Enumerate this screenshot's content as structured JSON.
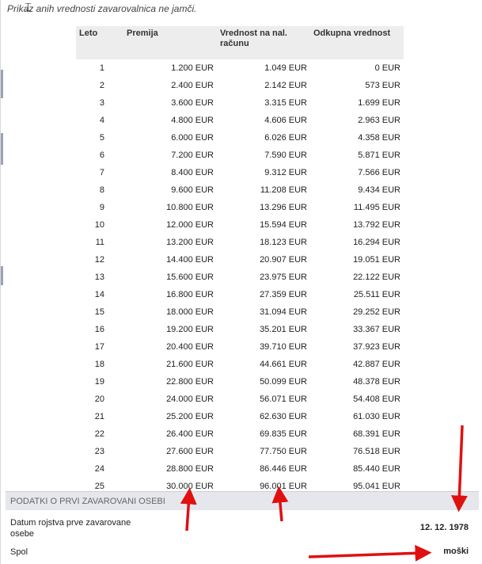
{
  "intro_text": "Prikaz anih vrednosti zavarovalnica ne jamči.",
  "table": {
    "headers": [
      "Leto",
      "Premija",
      "Vrednost na nal. računu",
      "Odkupna vrednost"
    ],
    "rows": [
      [
        "1",
        "1.200 EUR",
        "1.049 EUR",
        "0 EUR"
      ],
      [
        "2",
        "2.400 EUR",
        "2.142 EUR",
        "573 EUR"
      ],
      [
        "3",
        "3.600 EUR",
        "3.315 EUR",
        "1.699 EUR"
      ],
      [
        "4",
        "4.800 EUR",
        "4.606 EUR",
        "2.963 EUR"
      ],
      [
        "5",
        "6.000 EUR",
        "6.026 EUR",
        "4.358 EUR"
      ],
      [
        "6",
        "7.200 EUR",
        "7.590 EUR",
        "5.871 EUR"
      ],
      [
        "7",
        "8.400 EUR",
        "9.312 EUR",
        "7.566 EUR"
      ],
      [
        "8",
        "9.600 EUR",
        "11.208 EUR",
        "9.434 EUR"
      ],
      [
        "9",
        "10.800 EUR",
        "13.296 EUR",
        "11.495 EUR"
      ],
      [
        "10",
        "12.000 EUR",
        "15.594 EUR",
        "13.792 EUR"
      ],
      [
        "11",
        "13.200 EUR",
        "18.123 EUR",
        "16.294 EUR"
      ],
      [
        "12",
        "14.400 EUR",
        "20.907 EUR",
        "19.051 EUR"
      ],
      [
        "13",
        "15.600 EUR",
        "23.975 EUR",
        "22.122 EUR"
      ],
      [
        "14",
        "16.800 EUR",
        "27.359 EUR",
        "25.511 EUR"
      ],
      [
        "15",
        "18.000 EUR",
        "31.094 EUR",
        "29.252 EUR"
      ],
      [
        "16",
        "19.200 EUR",
        "35.201 EUR",
        "33.367 EUR"
      ],
      [
        "17",
        "20.400 EUR",
        "39.710 EUR",
        "37.923 EUR"
      ],
      [
        "18",
        "21.600 EUR",
        "44.661 EUR",
        "42.887 EUR"
      ],
      [
        "19",
        "22.800 EUR",
        "50.099 EUR",
        "48.378 EUR"
      ],
      [
        "20",
        "24.000 EUR",
        "56.071 EUR",
        "54.408 EUR"
      ],
      [
        "21",
        "25.200 EUR",
        "62.630 EUR",
        "61.030 EUR"
      ],
      [
        "22",
        "26.400 EUR",
        "69.835 EUR",
        "68.391 EUR"
      ],
      [
        "23",
        "27.600 EUR",
        "77.750 EUR",
        "76.518 EUR"
      ],
      [
        "24",
        "28.800 EUR",
        "86.446 EUR",
        "85.440 EUR"
      ],
      [
        "25",
        "30.000 EUR",
        "96.001 EUR",
        "95.041 EUR"
      ]
    ]
  },
  "section": {
    "title": "PODATKI O PRVI ZAVAROVANI OSEBI",
    "fields": [
      {
        "label": "Datum rojstva prve zavarovane osebe",
        "value": "12. 12. 1978"
      },
      {
        "label": "Spol",
        "value": "moški"
      }
    ]
  },
  "colors": {
    "annotation_arrow": "#e01010",
    "header_bg": "#ededed",
    "section_bg": "#e5e7ec"
  }
}
